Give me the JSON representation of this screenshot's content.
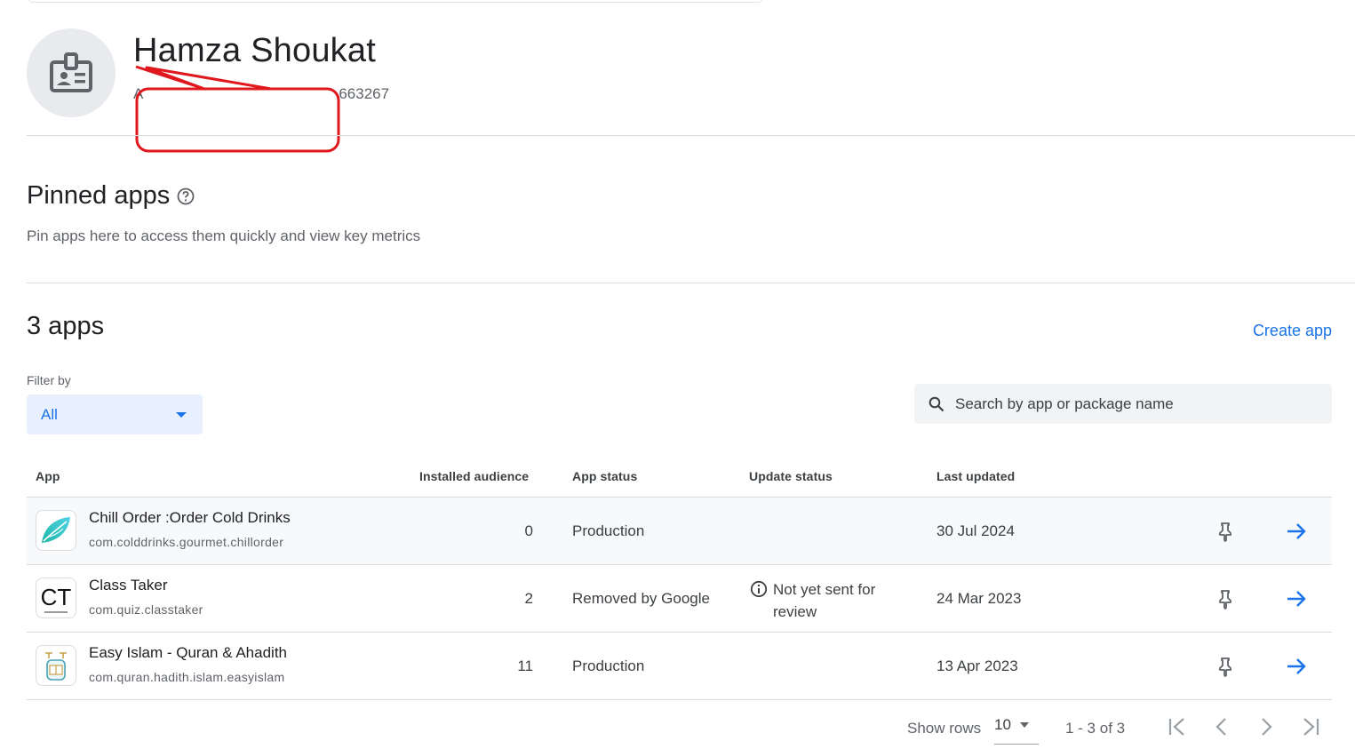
{
  "developer": {
    "name": "Hamza Shoukat",
    "account_id_prefix": "A",
    "account_id_suffix": "663267"
  },
  "pinned": {
    "title": "Pinned apps",
    "description": "Pin apps here to access them quickly and view key metrics"
  },
  "apps_section": {
    "count_label": "3 apps",
    "create_label": "Create app"
  },
  "filter": {
    "label": "Filter by",
    "value": "All"
  },
  "search": {
    "placeholder": "Search by app or package name"
  },
  "table": {
    "headers": [
      "App",
      "Installed audience",
      "App status",
      "Update status",
      "Last updated"
    ],
    "rows": [
      {
        "name": "Chill Order :Order Cold Drinks",
        "package": "com.colddrinks.gourmet.chillorder",
        "audience": "0",
        "status": "Production",
        "update_status": "",
        "last_updated": "30 Jul 2024",
        "icon": "chill-order-icon"
      },
      {
        "name": "Class Taker",
        "package": "com.quiz.classtaker",
        "audience": "2",
        "status": "Removed by Google",
        "update_status": "Not yet sent for review",
        "last_updated": "24 Mar 2023",
        "icon": "class-taker-icon",
        "icon_text": "CT"
      },
      {
        "name": "Easy Islam - Quran & Ahadith",
        "package": "com.quran.hadith.islam.easyislam",
        "audience": "11",
        "status": "Production",
        "update_status": "",
        "last_updated": "13 Apr 2023",
        "icon": "easy-islam-icon"
      }
    ]
  },
  "pagination": {
    "show_rows_label": "Show rows",
    "rows_value": "10",
    "range_label": "1 - 3 of 3"
  },
  "colors": {
    "accent": "#1a73e8",
    "annotation": "#e0181e",
    "row_hover": "#f8f9fa"
  }
}
